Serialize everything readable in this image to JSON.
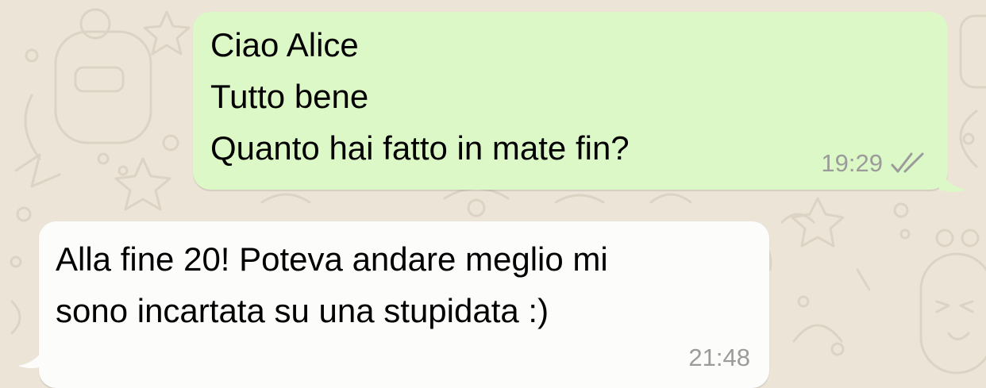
{
  "chat": {
    "messages": [
      {
        "direction": "outgoing",
        "lines": [
          "Ciao Alice",
          "Tutto bene",
          "Quanto hai fatto in mate fin?"
        ],
        "time": "19:29",
        "status_icon": "double-check-icon"
      },
      {
        "direction": "incoming",
        "lines": [
          "Alla fine 20! Poteva andare meglio mi",
          "sono incartata su una stupidata :)"
        ],
        "time": "21:48"
      }
    ]
  },
  "colors": {
    "background": "#ece4d6",
    "outgoing_bubble": "#dcf8c6",
    "incoming_bubble": "#fcfcfb",
    "meta_text": "#9b9b9b"
  }
}
